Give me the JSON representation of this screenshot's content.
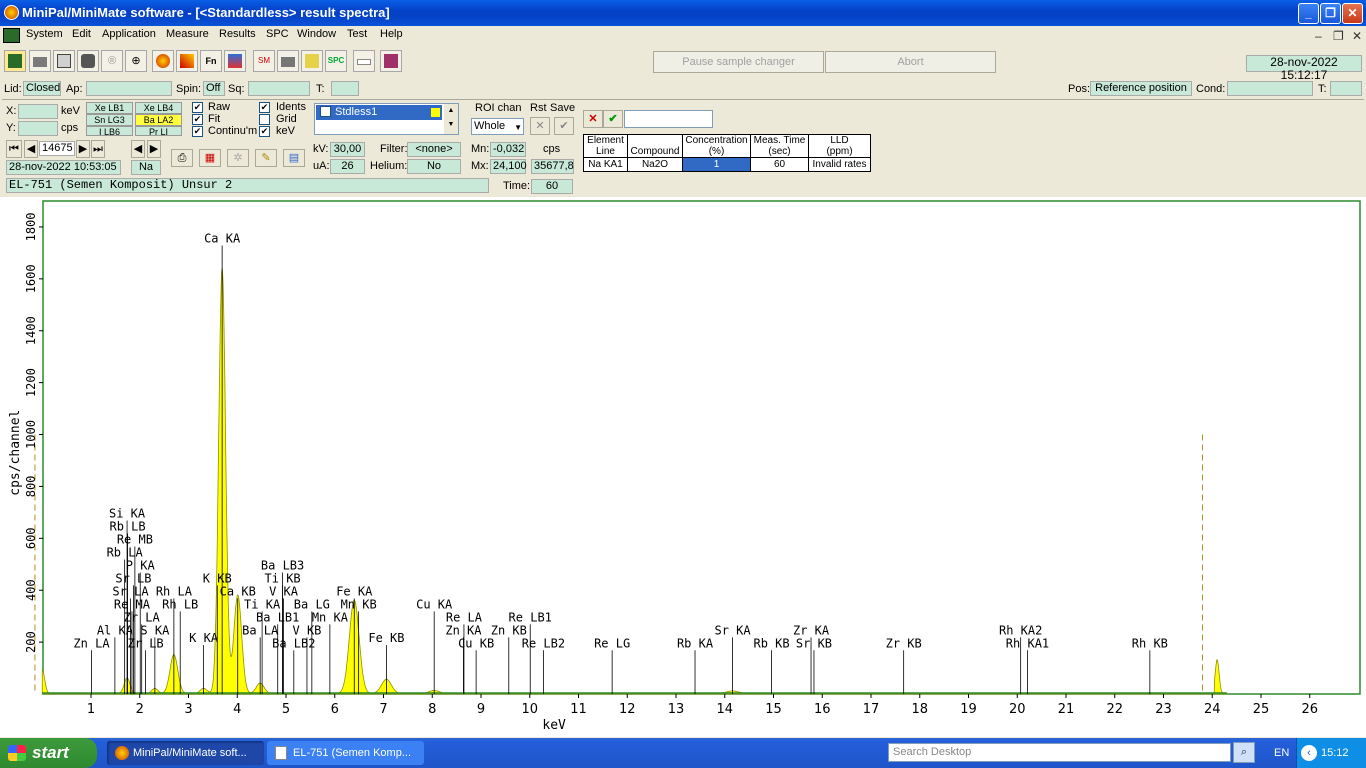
{
  "window": {
    "title": "MiniPal/MiniMate software - [<Standardless> result spectra]"
  },
  "menu": [
    "System",
    "Edit",
    "Application",
    "Measure",
    "Results",
    "SPC",
    "Window",
    "Test",
    "Help"
  ],
  "toolbar": {
    "pause_label": "Pause sample changer",
    "abort_label": "Abort",
    "datetime": "28-nov-2022 15:12:17"
  },
  "status": {
    "lid_label": "Lid:",
    "lid_value": "Closed",
    "ap_label": "Ap:",
    "spin_label": "Spin:",
    "spin_value": "Off",
    "sq_label": "Sq:",
    "t_label": "T:",
    "pos_label": "Pos:",
    "pos_value": "Reference position",
    "cond_label": "Cond:",
    "t2_label": "T:"
  },
  "cursor": {
    "x_label": "X:",
    "x_unit": "keV",
    "y_label": "Y:",
    "y_unit": "cps"
  },
  "lines_grid": [
    [
      "Xe LB1",
      "Xe LB4"
    ],
    [
      "Sn LG3",
      "Ba LA2"
    ],
    [
      "I LB6",
      "Pr LI"
    ]
  ],
  "options": {
    "raw": "Raw",
    "fit": "Fit",
    "continuum": "Continu'm",
    "idents": "Idents",
    "grid": "Grid",
    "kev": "keV"
  },
  "spectrum_list": {
    "item": "Stdless1"
  },
  "roi": {
    "label": "ROI chan",
    "value": "Whole",
    "rst_label": "Rst",
    "save_label": "Save",
    "mn_label": "Mn:",
    "mn_value": "-0,032",
    "mx_label": "Mx:",
    "mx_value": "24,100",
    "cps_label": "cps",
    "cps_value": "35677,8"
  },
  "nav": {
    "spectrum_number": "14675",
    "date": "28-nov-2022 10:53:05",
    "element": "Na"
  },
  "measure": {
    "kv_label": "kV:",
    "kv_value": "30,00",
    "ua_label": "uA:",
    "ua_value": "26",
    "filter_label": "Filter:",
    "filter_value": "<none>",
    "helium_label": "Helium:",
    "helium_value": "No",
    "time_label": "Time:",
    "time_value": "60"
  },
  "sample_name": "EL-751 (Semen Komposit) Unsur 2",
  "result_table": {
    "headers": [
      [
        "Element",
        "Line"
      ],
      [
        "Compound"
      ],
      [
        "Concentration",
        "(%)"
      ],
      [
        "Meas. Time",
        "(sec)"
      ],
      [
        "LLD",
        "(ppm)"
      ]
    ],
    "row": [
      "Na KA1",
      "Na2O",
      "1",
      "60",
      "Invalid rates"
    ]
  },
  "chart_data": {
    "type": "line",
    "xlabel": "keV",
    "ylabel": "cps/channel",
    "xlim": [
      0,
      26.5
    ],
    "ylim": [
      0,
      1900
    ],
    "x_ticks": [
      1,
      2,
      3,
      4,
      5,
      6,
      7,
      8,
      9,
      10,
      11,
      12,
      13,
      14,
      15,
      16,
      17,
      18,
      19,
      20,
      21,
      22,
      23,
      24,
      25,
      26
    ],
    "y_ticks": [
      200,
      400,
      600,
      800,
      1000,
      1200,
      1400,
      1600,
      1800
    ],
    "roi_markers_kev": [
      -0.15,
      23.8
    ],
    "spectrum_peaks": [
      {
        "kev": 0.0,
        "cps": 90,
        "width": 0.05
      },
      {
        "kev": 1.74,
        "cps": 60,
        "width": 0.06
      },
      {
        "kev": 2.31,
        "cps": 20,
        "width": 0.06
      },
      {
        "kev": 2.7,
        "cps": 150,
        "width": 0.08
      },
      {
        "kev": 3.31,
        "cps": 20,
        "width": 0.07
      },
      {
        "kev": 3.69,
        "cps": 1640,
        "width": 0.07
      },
      {
        "kev": 4.01,
        "cps": 380,
        "width": 0.08
      },
      {
        "kev": 4.47,
        "cps": 40,
        "width": 0.08
      },
      {
        "kev": 6.4,
        "cps": 360,
        "width": 0.1
      },
      {
        "kev": 7.06,
        "cps": 55,
        "width": 0.1
      },
      {
        "kev": 8.04,
        "cps": 12,
        "width": 0.1
      },
      {
        "kev": 14.16,
        "cps": 10,
        "width": 0.12
      },
      {
        "kev": 24.1,
        "cps": 130,
        "width": 0.04
      }
    ],
    "annotations": [
      {
        "text": "Ca KA",
        "kev": 3.69,
        "cps": 1740
      },
      {
        "text": "Si KA",
        "kev": 1.74,
        "cps": 680
      },
      {
        "text": "Rb LB",
        "kev": 1.75,
        "cps": 630
      },
      {
        "text": "Re MB",
        "kev": 1.9,
        "cps": 580
      },
      {
        "text": "Rb LA",
        "kev": 1.69,
        "cps": 530
      },
      {
        "text": "P KA",
        "kev": 2.01,
        "cps": 480
      },
      {
        "text": "Sr LB",
        "kev": 1.87,
        "cps": 430
      },
      {
        "text": "Sr LA",
        "kev": 1.81,
        "cps": 380
      },
      {
        "text": "Rh LA",
        "kev": 2.7,
        "cps": 380
      },
      {
        "text": "Re MA",
        "kev": 1.84,
        "cps": 330
      },
      {
        "text": "Rh LB",
        "kev": 2.83,
        "cps": 330
      },
      {
        "text": "Zr LA",
        "kev": 2.04,
        "cps": 280
      },
      {
        "text": "Al KA",
        "kev": 1.49,
        "cps": 230
      },
      {
        "text": "S KA",
        "kev": 2.31,
        "cps": 230
      },
      {
        "text": "Zn LA",
        "kev": 1.01,
        "cps": 180
      },
      {
        "text": "Zr LB",
        "kev": 2.12,
        "cps": 180
      },
      {
        "text": "K KA",
        "kev": 3.31,
        "cps": 200
      },
      {
        "text": "K KB",
        "kev": 3.59,
        "cps": 430
      },
      {
        "text": "Ca KB",
        "kev": 4.01,
        "cps": 380
      },
      {
        "text": "Ba LB3",
        "kev": 4.93,
        "cps": 480
      },
      {
        "text": "Ti KB",
        "kev": 4.93,
        "cps": 430
      },
      {
        "text": "V KA",
        "kev": 4.95,
        "cps": 380
      },
      {
        "text": "Ba LG",
        "kev": 5.53,
        "cps": 330
      },
      {
        "text": "Ti KA",
        "kev": 4.51,
        "cps": 330
      },
      {
        "text": "Ba LB1",
        "kev": 4.83,
        "cps": 280
      },
      {
        "text": "Mn KA",
        "kev": 5.9,
        "cps": 280
      },
      {
        "text": "Ba LA",
        "kev": 4.47,
        "cps": 230
      },
      {
        "text": "V KB",
        "kev": 5.43,
        "cps": 230
      },
      {
        "text": "Ba LB2",
        "kev": 5.16,
        "cps": 180
      },
      {
        "text": "Fe KA",
        "kev": 6.4,
        "cps": 380
      },
      {
        "text": "Mn KB",
        "kev": 6.49,
        "cps": 330
      },
      {
        "text": "Fe KB",
        "kev": 7.06,
        "cps": 200
      },
      {
        "text": "Cu KA",
        "kev": 8.04,
        "cps": 330
      },
      {
        "text": "Re LA",
        "kev": 8.65,
        "cps": 280
      },
      {
        "text": "Zn KA",
        "kev": 8.64,
        "cps": 230
      },
      {
        "text": "Zn KB",
        "kev": 9.57,
        "cps": 230
      },
      {
        "text": "Cu KB",
        "kev": 8.9,
        "cps": 180
      },
      {
        "text": "Re LB1",
        "kev": 10.01,
        "cps": 280
      },
      {
        "text": "Re LB2",
        "kev": 10.28,
        "cps": 180
      },
      {
        "text": "Re LG",
        "kev": 11.69,
        "cps": 180
      },
      {
        "text": "Rb KA",
        "kev": 13.39,
        "cps": 180
      },
      {
        "text": "Sr KA",
        "kev": 14.16,
        "cps": 230
      },
      {
        "text": "Rb KB",
        "kev": 14.96,
        "cps": 180
      },
      {
        "text": "Zr KA",
        "kev": 15.77,
        "cps": 230
      },
      {
        "text": "Sr KB",
        "kev": 15.83,
        "cps": 180
      },
      {
        "text": "Zr KB",
        "kev": 17.67,
        "cps": 180
      },
      {
        "text": "Rh KA2",
        "kev": 20.07,
        "cps": 230
      },
      {
        "text": "Rh KA1",
        "kev": 20.21,
        "cps": 180
      },
      {
        "text": "Rh KB",
        "kev": 22.72,
        "cps": 180
      }
    ]
  },
  "taskbar": {
    "start": "start",
    "tasks": [
      "MiniPal/MiniMate soft...",
      "EL-751 (Semen Komp..."
    ],
    "search_placeholder": "Search Desktop",
    "lang": "EN",
    "clock": "15:12"
  }
}
